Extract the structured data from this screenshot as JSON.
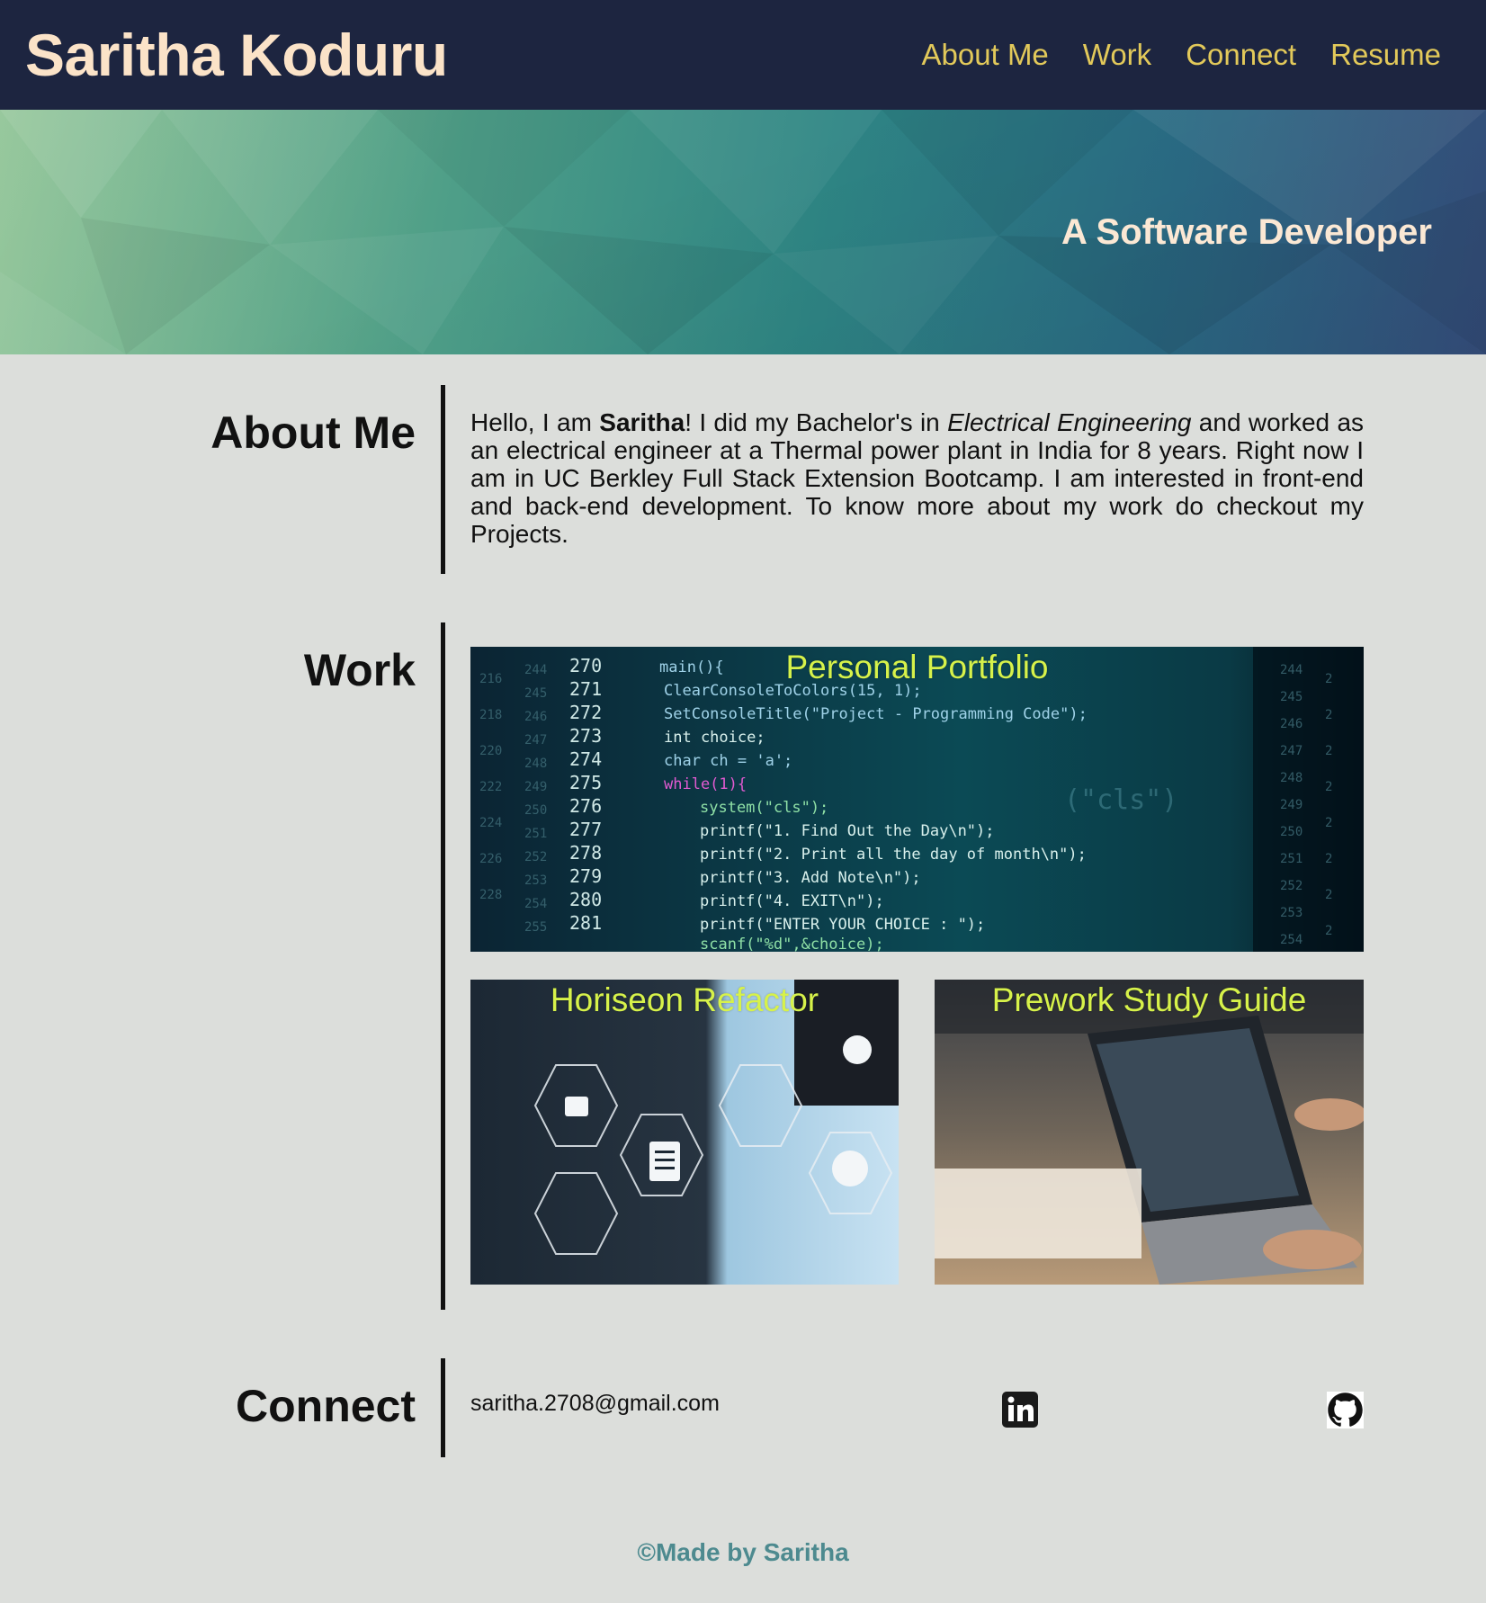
{
  "header": {
    "site_title": "Saritha Koduru",
    "nav": [
      "About Me",
      "Work",
      "Connect",
      "Resume"
    ]
  },
  "hero": {
    "subtitle": "A Software Developer"
  },
  "about": {
    "heading": "About Me",
    "intro": "Hello, I am ",
    "name": "Saritha",
    "after_name": "! I did my Bachelor's in ",
    "degree": "Electrical Engineering",
    "rest": " and worked as an electrical engineer at a Thermal power plant in India for 8 years. Right now I am in UC Berkley Full Stack Extension Bootcamp. I am interested in front-end and back-end development. To know more about my work do checkout my Projects."
  },
  "work": {
    "heading": "Work",
    "projects": [
      {
        "title": "Personal Portfolio"
      },
      {
        "title": "Horiseon Refactor"
      },
      {
        "title": "Prework Study Guide"
      }
    ]
  },
  "connect": {
    "heading": "Connect",
    "email": "saritha.2708@gmail.com",
    "icons": [
      "linkedin-icon",
      "github-icon"
    ]
  },
  "footer": {
    "text": "©Made by Saritha"
  },
  "colors": {
    "header_bg": "#1d2540",
    "title_color": "#fbe3c8",
    "nav_color": "#e2c95a",
    "page_bg": "#dcdedb",
    "card_title": "#d7f24a",
    "footer_text": "#4d8a8f"
  }
}
